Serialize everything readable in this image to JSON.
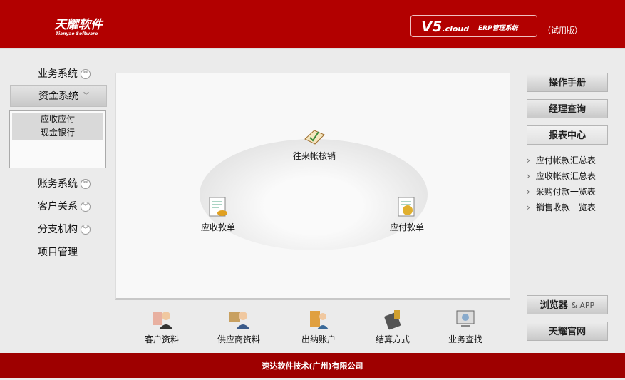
{
  "header": {
    "logo": "天耀软件",
    "logo_sub": "Tianyao Software",
    "version": "V5",
    "version_suffix": ".cloud",
    "product": "ERP管理系统",
    "edition": "（试用版）"
  },
  "nav": [
    {
      "label": "业务系统"
    },
    {
      "label": "资金系统"
    },
    {
      "label": "账务系统"
    },
    {
      "label": "客户关系"
    },
    {
      "label": "分支机构"
    },
    {
      "label": "项目管理"
    }
  ],
  "submenu": [
    "应收应付",
    "现金银行"
  ],
  "flow": {
    "top": "往来帐核销",
    "left": "应收款单",
    "right": "应付款单"
  },
  "bottom": [
    "客户资料",
    "供应商资料",
    "出纳账户",
    "结算方式",
    "业务查找"
  ],
  "right": {
    "manual": "操作手册",
    "manager": "经理查询",
    "reports": "报表中心",
    "links": [
      "应付帐款汇总表",
      "应收帐款汇总表",
      "采购付款一览表",
      "销售收款一览表"
    ],
    "browser": "浏览器",
    "app": "& APP",
    "site": "天耀官网"
  },
  "footer": "速达软件技术(广州)有限公司"
}
